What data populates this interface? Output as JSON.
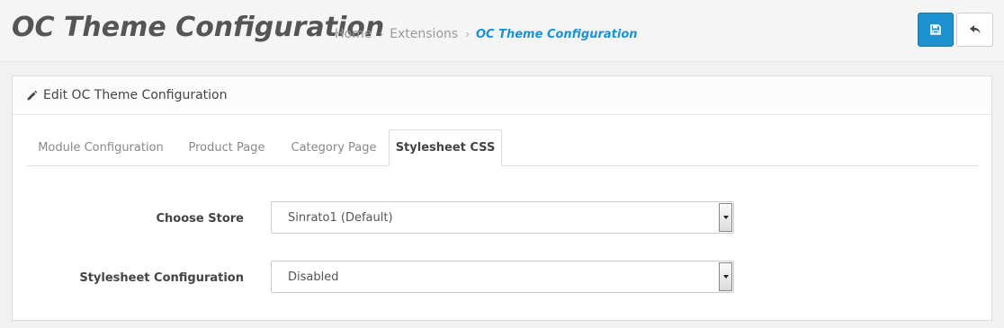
{
  "header": {
    "title": "OC Theme Configuration",
    "breadcrumb": [
      {
        "label": "Home"
      },
      {
        "label": "Extensions"
      },
      {
        "label": "OC Theme Configuration"
      }
    ],
    "breadcrumb_separator": "›",
    "save_icon": "save-icon",
    "back_icon": "reply-icon"
  },
  "panel": {
    "title": "Edit OC Theme Configuration",
    "icon": "pencil-icon"
  },
  "tabs": [
    {
      "label": "Module Configuration"
    },
    {
      "label": "Product Page"
    },
    {
      "label": "Category Page"
    },
    {
      "label": "Stylesheet CSS",
      "active": true
    }
  ],
  "form": {
    "store_label": "Choose Store",
    "store_value": "Sinrato1 (Default)",
    "stylesheet_label": "Stylesheet Configuration",
    "stylesheet_value": "Disabled"
  },
  "colors": {
    "accent": "#1e91cf",
    "title": "#555555"
  }
}
